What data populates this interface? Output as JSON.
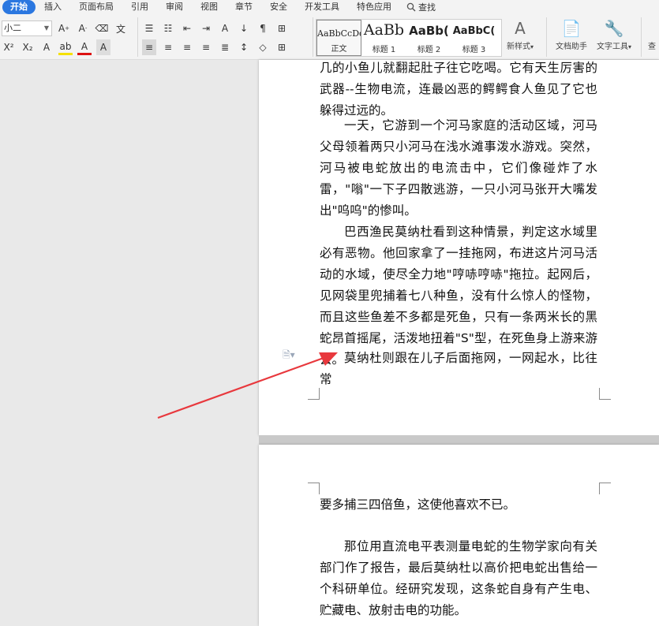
{
  "menu": {
    "items": [
      "开始",
      "插入",
      "页面布局",
      "引用",
      "审阅",
      "视图",
      "章节",
      "安全",
      "开发工具",
      "特色应用"
    ],
    "search_label": "查找"
  },
  "ribbon": {
    "font_size": "小二",
    "styles": [
      {
        "sample": "AaBbCcDd",
        "label": "正文"
      },
      {
        "sample": "AaBb",
        "label": "标题 1"
      },
      {
        "sample": "AaBb(",
        "label": "标题 2"
      },
      {
        "sample": "AaBbC(",
        "label": "标题 3"
      }
    ],
    "new_style_label": "新样式",
    "doc_assistant_label": "文档助手",
    "text_tools_label": "文字工具",
    "overflow_label": "查"
  },
  "document": {
    "page1_paragraphs": [
      "几的小鱼儿就翻起肚子往它吃喝。它有天生厉害的武器--生物电流，连最凶恶的鳄鳄食人鱼见了它也躲得过远的。",
      "一天，它游到一个河马家庭的活动区域，河马父母领着两只小河马在浅水滩事泼水游戏。突然，河马被电蛇放出的电流击中，它们像碰炸了水雷，\"嗡\"一下子四散逃游，一只小河马张开大嘴发出\"呜呜\"的惨叫。",
      "巴西渔民莫纳杜看到这种情景，判定这水域里必有恶物。他回家拿了一挂拖网，布进这片河马活动的水域，使尽全力地\"哼哧哼哧\"拖拉。起网后，见网袋里兜捕着七八种鱼，没有什么惊人的怪物，而且这些鱼差不多都是死鱼，只有一条两米长的黑蛇昂首摇尾，活泼地扭着\"S\"型，在死鱼身上游来游去。",
      "莫纳杜则跟在儿子后面拖网，一网起水，比往常"
    ],
    "page2_paragraphs": [
      "要多捕三四倍鱼，这使他喜欢不已。",
      "那位用直流电平表测量电蛇的生物学家向有关部门作了报告，最后莫纳杜以高价把电蛇出售给一个科研单位。经研究发现，这条蛇自身有产生电、贮藏电、放射击电的功能。"
    ]
  },
  "colors": {
    "accent": "#2b77e0",
    "arrow": "#e8383d"
  }
}
